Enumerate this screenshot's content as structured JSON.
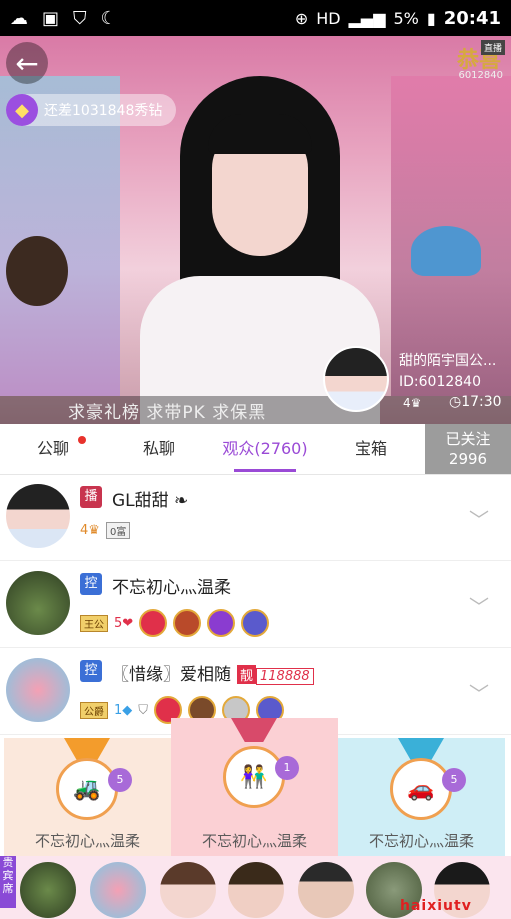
{
  "status_bar": {
    "battery": "5%",
    "time": "20:41",
    "network": "HD"
  },
  "stream": {
    "gap_text": "还差1031848秀钻",
    "brand_text": "恭喜",
    "brand_id": "6012840",
    "brand_badge": "直播",
    "slogan": "求豪礼榜   求带PK   求保黑",
    "host": {
      "name": "甜的陌宇国公...",
      "id_text": "ID:6012840",
      "level": "4",
      "duration": "17:30"
    }
  },
  "tabs": [
    {
      "label": "公聊",
      "has_dot": true
    },
    {
      "label": "私聊",
      "has_dot": false
    },
    {
      "label": "观众(2760)",
      "active": true
    },
    {
      "label": "宝箱"
    }
  ],
  "follow": {
    "line1": "已关注",
    "line2": "2996"
  },
  "audience": [
    {
      "role": "播",
      "role_color": "#c8344e",
      "name": "GL甜甜",
      "level": "4",
      "tag": "0富"
    },
    {
      "role": "控",
      "role_color": "#3b6fd6",
      "name": "不忘初心灬温柔",
      "level": "5",
      "tag": "王公"
    },
    {
      "role": "控",
      "role_color": "#3b6fd6",
      "name": "〖惜缘〗爱相随",
      "level": "1",
      "tag": "公爵",
      "pretty_label": "靓",
      "pretty_number": "118888"
    }
  ],
  "ranks": [
    {
      "name": "不忘初心灬温柔",
      "count": "5",
      "gift": "🚜"
    },
    {
      "name": "不忘初心灬温柔",
      "count": "1",
      "gift": "👫"
    },
    {
      "name": "不忘初心灬温柔",
      "count": "5",
      "gift": "🚗"
    }
  ],
  "bottom": {
    "vip_label": "贵宾席",
    "watermark": "haixiutv"
  }
}
